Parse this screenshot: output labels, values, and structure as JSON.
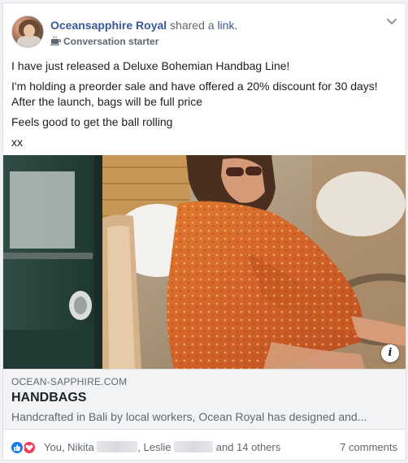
{
  "post": {
    "author": "Oceansapphire Royal",
    "action_text": "shared a",
    "action_link": "link.",
    "badge_label": "Conversation starter",
    "badge_icon": "coffee-cup-icon",
    "menu_icon": "chevron-down-icon",
    "body_lines": [
      "I have just released a Deluxe Bohemian Handbag Line!",
      "I'm holding a preorder sale and have offered a 20% discount for 30 days!",
      "After the launch, bags will be full price",
      "Feels good to get the ball rolling",
      "xx"
    ]
  },
  "link_preview": {
    "domain": "OCEAN-SAPPHIRE.COM",
    "title": "HANDBAGS",
    "description": "Handcrafted in Bali by local workers, Ocean Royal has designed and...",
    "info_label": "i"
  },
  "footer": {
    "reaction_icons": [
      "like-icon",
      "love-icon"
    ],
    "reactors_part1": "You, Nikita",
    "reactors_part2": ", Leslie",
    "reactors_part3": "and 14 others",
    "comments": "7 comments"
  },
  "colors": {
    "link_blue": "#385898",
    "like_blue": "#1877f2",
    "love_red": "#f33e58",
    "muted_text": "#606770",
    "preview_bg": "#f2f3f5"
  }
}
